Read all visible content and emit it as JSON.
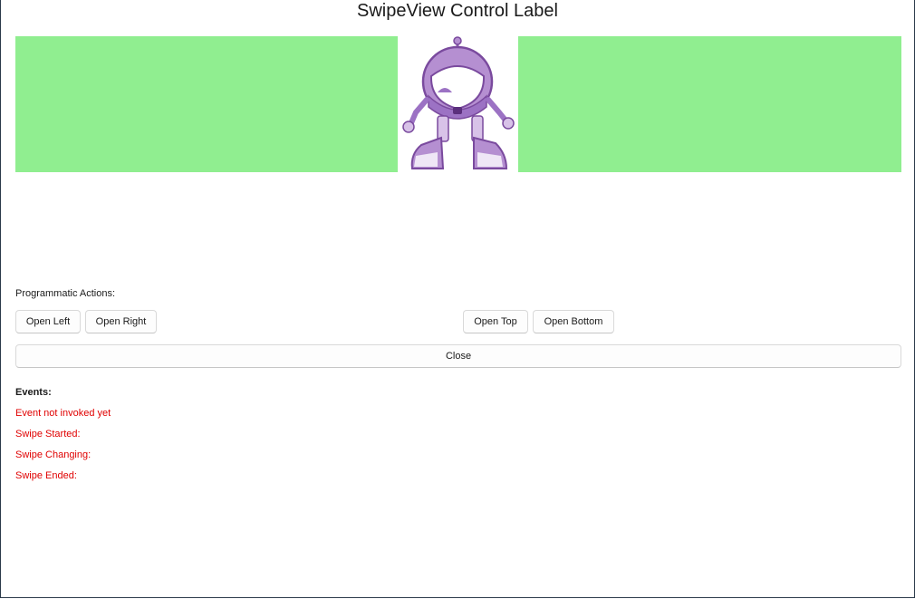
{
  "window": {
    "title": "SwipeView Control Label"
  },
  "swipe": {
    "content_color": "#90ee90",
    "image": "dotnet-bot-robot-image"
  },
  "actions": {
    "label": "Programmatic Actions:",
    "open_left": "Open Left",
    "open_right": "Open Right",
    "open_top": "Open Top",
    "open_bottom": "Open Bottom",
    "close": "Close"
  },
  "events": {
    "label": "Events:",
    "items": [
      "Event not invoked yet",
      "Swipe Started:",
      "Swipe Changing:",
      "Swipe Ended:"
    ],
    "color": "#e00000"
  }
}
